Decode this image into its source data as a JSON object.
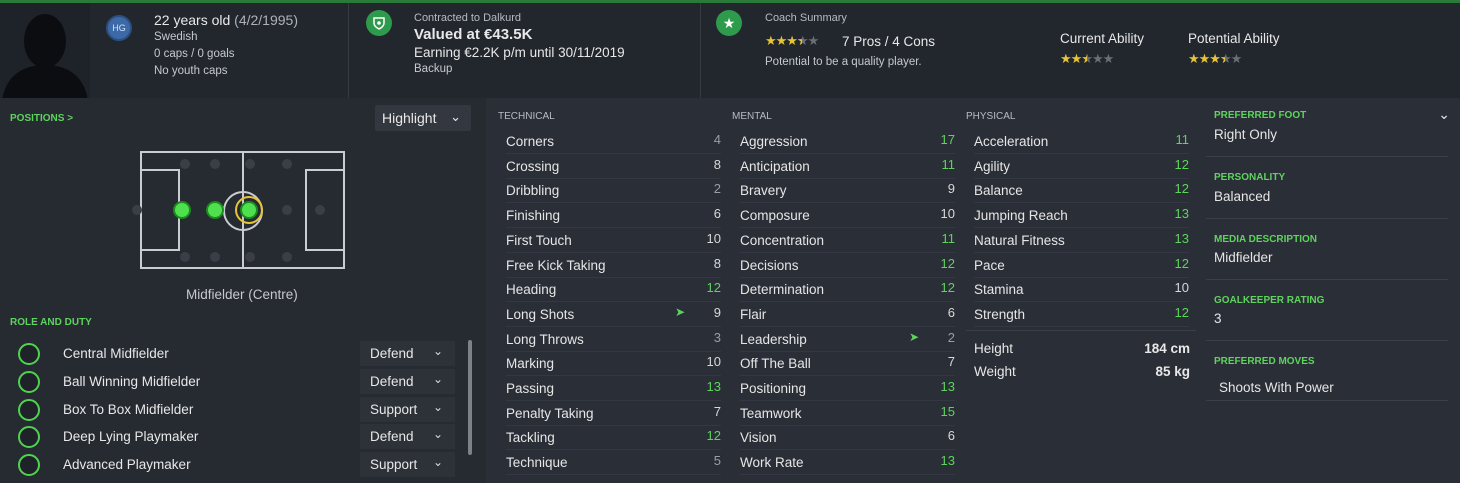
{
  "header": {
    "age_line": "22 years old",
    "dob": "(4/2/1995)",
    "nationality": "Swedish",
    "caps": "0 caps / 0 goals",
    "youth_caps": "No youth caps",
    "hg_badge": "HG",
    "contract_label": "Contracted to Dalkurd",
    "value": "Valued at €43.5K",
    "earning": "Earning €2.2K p/m until 30/11/2019",
    "squad_status": "Backup",
    "coach_summary_label": "Coach Summary",
    "pros_cons": "7 Pros / 4 Cons",
    "coach_note": "Potential to be a quality player.",
    "current_ability_label": "Current Ability",
    "potential_ability_label": "Potential Ability",
    "coach_stars": 3.5,
    "current_ability_stars": 2.5,
    "potential_ability_stars": 3.5
  },
  "positions": {
    "label": "POSITIONS >",
    "highlight": "Highlight",
    "position_name": "Midfielder (Centre)"
  },
  "roles": {
    "label": "ROLE AND DUTY",
    "items": [
      {
        "name": "Central Midfielder",
        "duty": "Defend"
      },
      {
        "name": "Ball Winning Midfielder",
        "duty": "Defend"
      },
      {
        "name": "Box To Box Midfielder",
        "duty": "Support"
      },
      {
        "name": "Deep Lying Playmaker",
        "duty": "Defend"
      },
      {
        "name": "Advanced Playmaker",
        "duty": "Support"
      }
    ]
  },
  "technical": {
    "label": "TECHNICAL",
    "items": [
      {
        "name": "Corners",
        "value": "4"
      },
      {
        "name": "Crossing",
        "value": "8"
      },
      {
        "name": "Dribbling",
        "value": "2"
      },
      {
        "name": "Finishing",
        "value": "6"
      },
      {
        "name": "First Touch",
        "value": "10"
      },
      {
        "name": "Free Kick Taking",
        "value": "8"
      },
      {
        "name": "Heading",
        "value": "12"
      },
      {
        "name": "Long Shots",
        "value": "9"
      },
      {
        "name": "Long Throws",
        "value": "3"
      },
      {
        "name": "Marking",
        "value": "10"
      },
      {
        "name": "Passing",
        "value": "13"
      },
      {
        "name": "Penalty Taking",
        "value": "7"
      },
      {
        "name": "Tackling",
        "value": "12"
      },
      {
        "name": "Technique",
        "value": "5"
      }
    ]
  },
  "mental": {
    "label": "MENTAL",
    "items": [
      {
        "name": "Aggression",
        "value": "17"
      },
      {
        "name": "Anticipation",
        "value": "11"
      },
      {
        "name": "Bravery",
        "value": "9"
      },
      {
        "name": "Composure",
        "value": "10"
      },
      {
        "name": "Concentration",
        "value": "11"
      },
      {
        "name": "Decisions",
        "value": "12"
      },
      {
        "name": "Determination",
        "value": "12"
      },
      {
        "name": "Flair",
        "value": "6"
      },
      {
        "name": "Leadership",
        "value": "2"
      },
      {
        "name": "Off The Ball",
        "value": "7"
      },
      {
        "name": "Positioning",
        "value": "13"
      },
      {
        "name": "Teamwork",
        "value": "15"
      },
      {
        "name": "Vision",
        "value": "6"
      },
      {
        "name": "Work Rate",
        "value": "13"
      }
    ]
  },
  "physical": {
    "label": "PHYSICAL",
    "items": [
      {
        "name": "Acceleration",
        "value": "11"
      },
      {
        "name": "Agility",
        "value": "12"
      },
      {
        "name": "Balance",
        "value": "12"
      },
      {
        "name": "Jumping Reach",
        "value": "13"
      },
      {
        "name": "Natural Fitness",
        "value": "13"
      },
      {
        "name": "Pace",
        "value": "12"
      },
      {
        "name": "Stamina",
        "value": "10"
      },
      {
        "name": "Strength",
        "value": "12"
      }
    ],
    "height_label": "Height",
    "height": "184 cm",
    "weight_label": "Weight",
    "weight": "85 kg"
  },
  "info": {
    "preferred_foot_label": "PREFERRED FOOT",
    "preferred_foot": "Right Only",
    "personality_label": "PERSONALITY",
    "personality": "Balanced",
    "media_label": "MEDIA DESCRIPTION",
    "media": "Midfielder",
    "gk_label": "GOALKEEPER RATING",
    "gk": "3",
    "moves_label": "PREFERRED MOVES",
    "moves": "Shoots With Power"
  },
  "colors": {
    "white_value": "#d8d8d8",
    "green_value": "#5ed35e",
    "low_value": "#9a9da3"
  }
}
